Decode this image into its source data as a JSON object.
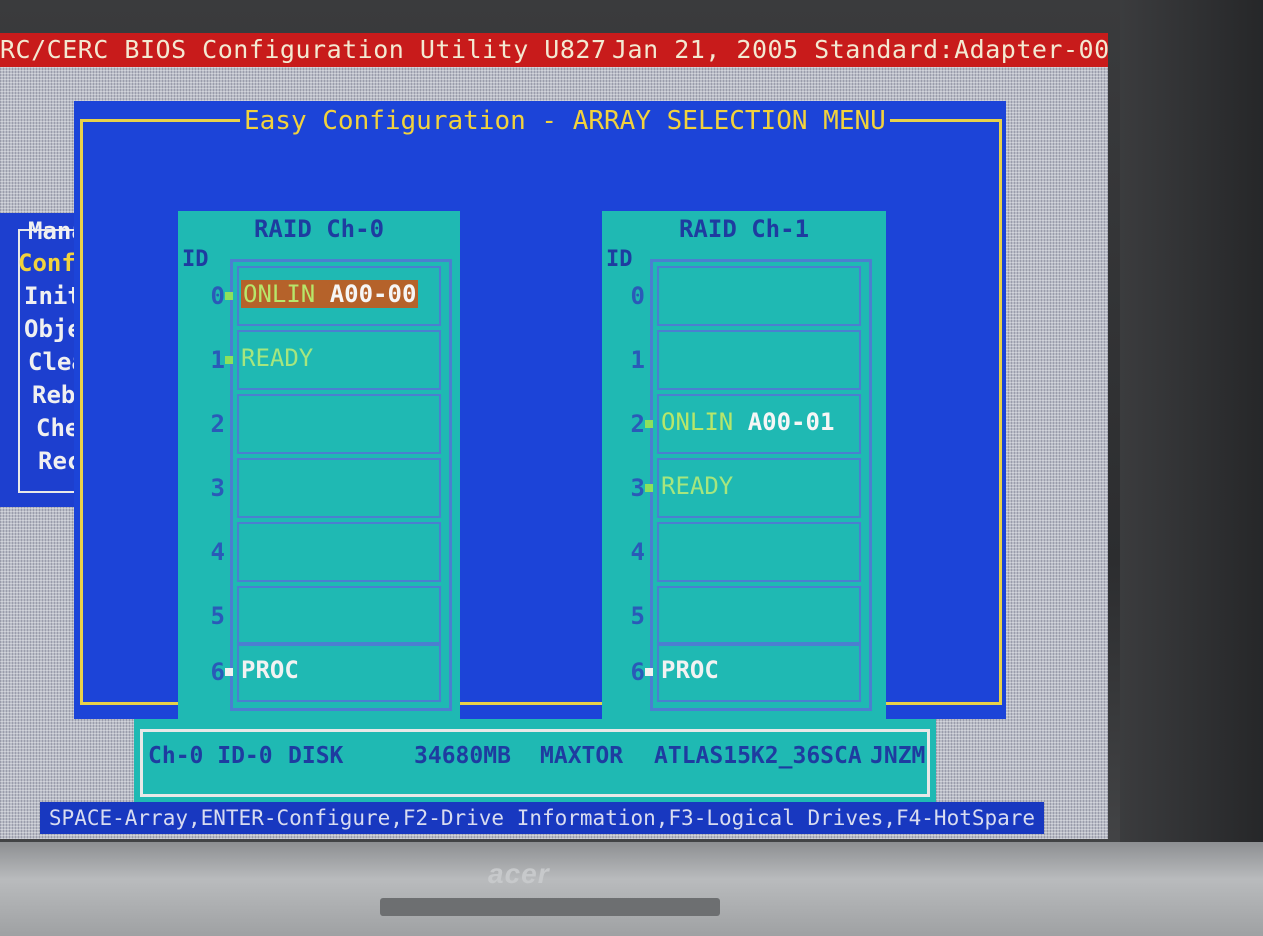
{
  "titlebar": {
    "left": "RC/CERC BIOS Configuration Utility U827",
    "right": "Jan 21, 2005 Standard:Adapter-00"
  },
  "mainmenu": {
    "title": "Mana",
    "items": [
      "Confi",
      "Initi",
      "Objec",
      "Clear",
      "Rebui",
      "Check",
      "Recon"
    ]
  },
  "dialog": {
    "title": "Easy Configuration - ARRAY SELECTION MENU"
  },
  "channels": [
    {
      "title": "RAID Ch-0",
      "id_label": "ID",
      "slots": [
        {
          "id": "0",
          "status": "ONLIN",
          "array": "A00-00"
        },
        {
          "id": "1",
          "status": "READY",
          "array": ""
        },
        {
          "id": "2",
          "status": "",
          "array": ""
        },
        {
          "id": "3",
          "status": "",
          "array": ""
        },
        {
          "id": "4",
          "status": "",
          "array": ""
        },
        {
          "id": "5",
          "status": "",
          "array": ""
        },
        {
          "id": "6",
          "status": "PROC",
          "array": ""
        }
      ]
    },
    {
      "title": "RAID Ch-1",
      "id_label": "ID",
      "slots": [
        {
          "id": "0",
          "status": "",
          "array": ""
        },
        {
          "id": "1",
          "status": "",
          "array": ""
        },
        {
          "id": "2",
          "status": "ONLIN",
          "array": "A00-01"
        },
        {
          "id": "3",
          "status": "READY",
          "array": ""
        },
        {
          "id": "4",
          "status": "",
          "array": ""
        },
        {
          "id": "5",
          "status": "",
          "array": ""
        },
        {
          "id": "6",
          "status": "PROC",
          "array": ""
        }
      ]
    }
  ],
  "info": {
    "location": "Ch-0 ID-0",
    "type": "DISK",
    "size": "34680MB",
    "vendor": "MAXTOR",
    "model": "ATLAS15K2_36SCA",
    "rev": "JNZM"
  },
  "help": "SPACE-Array,ENTER-Configure,F2-Drive Information,F3-Logical Drives,F4-HotSpare",
  "monitor": {
    "brand": "acer"
  },
  "colors": {
    "titlebar": "#c81b1b",
    "dialog": "#1c44d8",
    "panel": "#1fb9b3",
    "accent": "#f2d23c",
    "highlight": "#b5622a"
  }
}
